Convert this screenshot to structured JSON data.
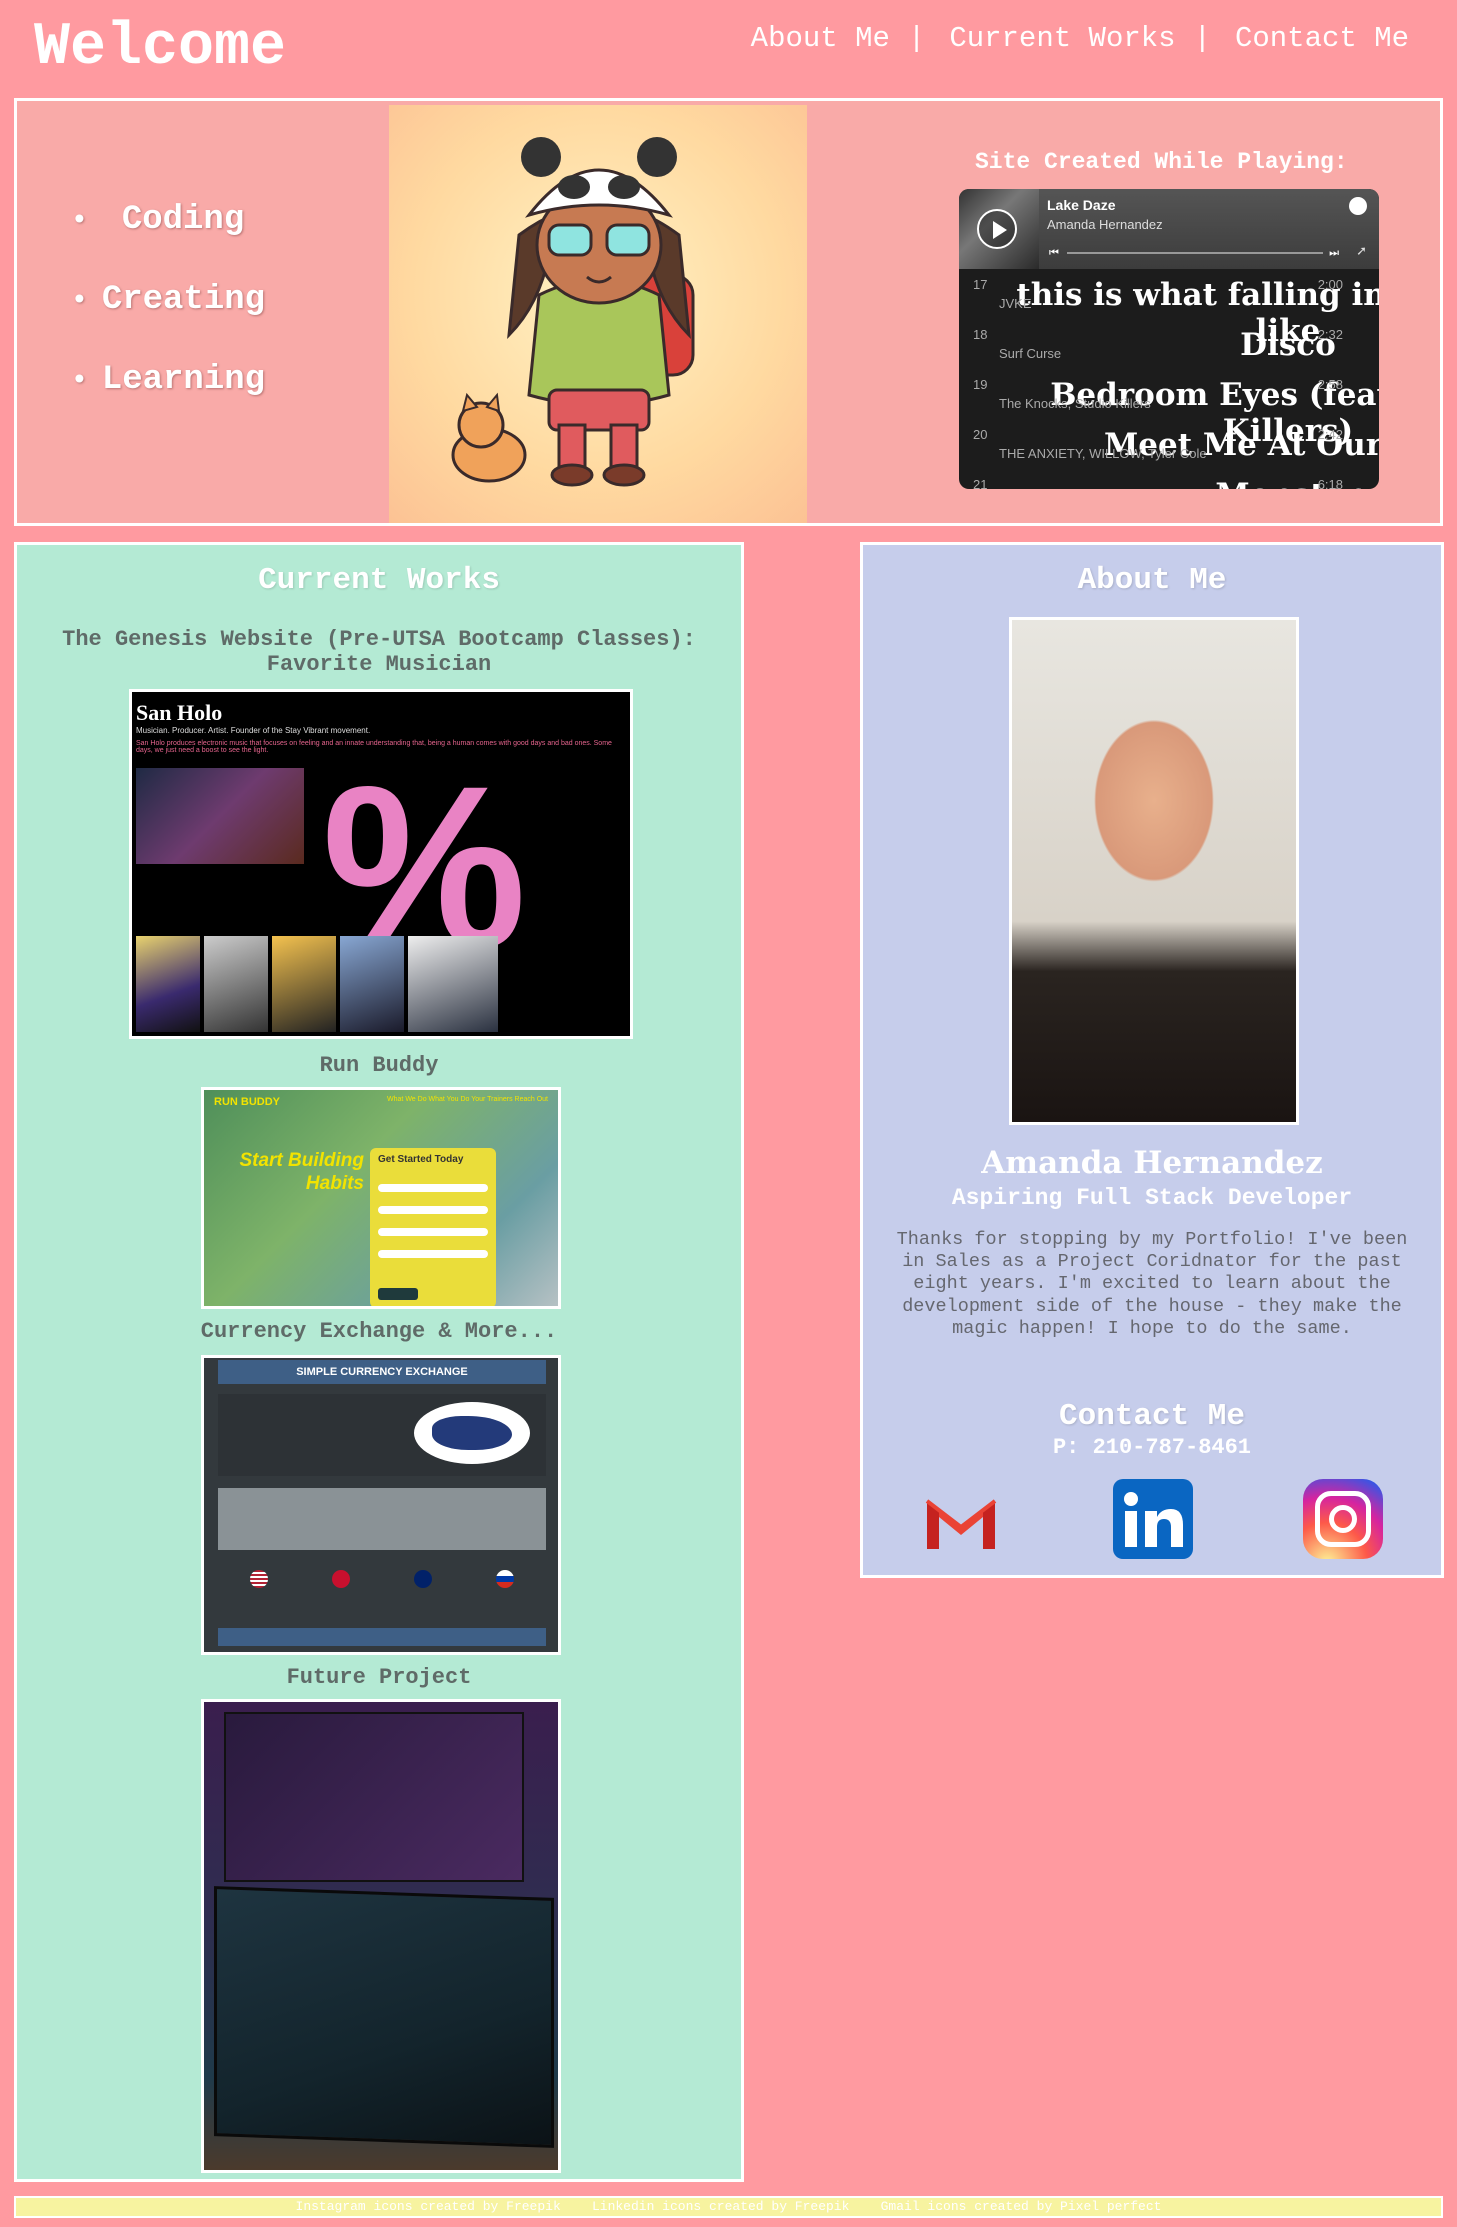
{
  "header": {
    "title": "Welcome",
    "nav": [
      {
        "label": "About Me"
      },
      {
        "label": "Current Works"
      },
      {
        "label": "Contact Me"
      }
    ],
    "separator": "|"
  },
  "hero": {
    "bullets": [
      "Coding",
      "Creating",
      "Learning"
    ],
    "playing_title": "Site Created While Playing:",
    "player": {
      "playlist": "Lake Daze",
      "owner": "Amanda Hernandez",
      "tracks": [
        {
          "num": "17",
          "title": "this is what falling in love feels like",
          "artist": "JVKE",
          "duration": "2:00"
        },
        {
          "num": "18",
          "title": "Disco",
          "artist": "Surf Curse",
          "duration": "2:32"
        },
        {
          "num": "19",
          "title": "Bedroom Eyes (feat. Studio Killers)",
          "artist": "The Knocks, Studio Killers",
          "duration": "2:58"
        },
        {
          "num": "20",
          "title": "Meet Me At Our Spot",
          "artist": "THE ANXIETY, WILLOW, Tyler Cole",
          "duration": "2:42"
        },
        {
          "num": "21",
          "title": "Monster",
          "artist": "",
          "duration": "6:18"
        }
      ]
    }
  },
  "works": {
    "title": "Current Works",
    "projects": [
      {
        "title": "The Genesis Website (Pre-UTSA Bootcamp Classes): Favorite Musician"
      },
      {
        "title": "Run Buddy"
      },
      {
        "title": "Currency Exchange & More..."
      },
      {
        "title": "Future Project"
      }
    ],
    "sanholo": {
      "name": "San Holo",
      "subtitle": "Musician. Producer. Artist. Founder of the Stay Vibrant movement.",
      "desc": "San Holo produces electronic music that focuses on feeling and an innate understanding that, being a human comes with good days and bad ones. Some days, we just need a boost to see the light."
    },
    "runbuddy": {
      "logo": "RUN BUDDY",
      "nav": "What We Do   What You Do   Your Trainers   Reach Out",
      "slogan": "Start Building Habits",
      "form_title": "Get Started Today"
    },
    "currency": {
      "header": "SIMPLE CURRENCY EXCHANGE"
    }
  },
  "about": {
    "title": "About Me",
    "name": "Amanda Hernandez",
    "role": "Aspiring Full Stack Developer",
    "bio": "Thanks for stopping by my Portfolio! I've been in Sales as a Project Coridnator for the past eight years. I'm excited to learn about the development side of the house - they make the magic happen! I hope to do the same.",
    "contact_title": "Contact Me",
    "phone": "P: 210-787-8461",
    "icons": [
      "gmail-icon",
      "linkedin-icon",
      "instagram-icon"
    ]
  },
  "footer": {
    "text": "Instagram icons created by Freepik    Linkedin icons created by Freepik    Gmail icons created by Pixel perfect"
  },
  "colors": {
    "background": "#ff9aa0",
    "hero": "#f9aaa8",
    "works": "#b4ead4",
    "about": "#c6cdeb",
    "footer": "#f7f3a0"
  }
}
